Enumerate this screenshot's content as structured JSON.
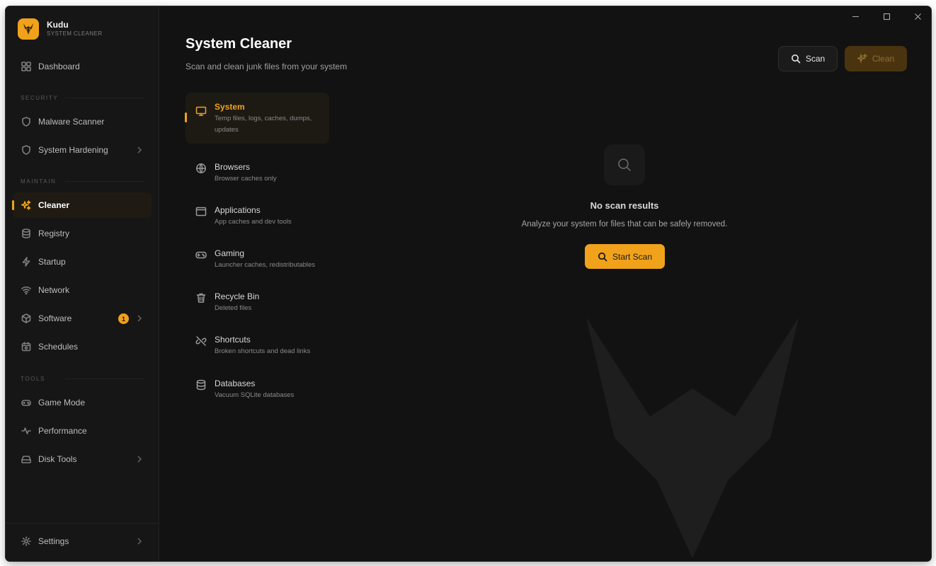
{
  "app": {
    "name": "Kudu",
    "subtitle": "SYSTEM CLEANER"
  },
  "sidebar": {
    "dashboard": "Dashboard",
    "sections": {
      "security": "SECURITY",
      "maintain": "MAINTAIN",
      "tools": "TOOLS"
    },
    "items": {
      "malware_scanner": "Malware Scanner",
      "system_hardening": "System Hardening",
      "cleaner": "Cleaner",
      "registry": "Registry",
      "startup": "Startup",
      "network": "Network",
      "software": "Software",
      "software_badge": "1",
      "schedules": "Schedules",
      "game_mode": "Game Mode",
      "performance": "Performance",
      "disk_tools": "Disk Tools"
    },
    "settings": "Settings"
  },
  "header": {
    "title": "System Cleaner",
    "subtitle": "Scan and clean junk files from your system",
    "scan_label": "Scan",
    "clean_label": "Clean"
  },
  "categories": [
    {
      "title": "System",
      "desc": "Temp files, logs, caches, dumps, updates",
      "icon": "monitor-icon"
    },
    {
      "title": "Browsers",
      "desc": "Browser caches only",
      "icon": "globe-icon"
    },
    {
      "title": "Applications",
      "desc": "App caches and dev tools",
      "icon": "app-window-icon"
    },
    {
      "title": "Gaming",
      "desc": "Launcher caches, redistributables",
      "icon": "gamepad-icon"
    },
    {
      "title": "Recycle Bin",
      "desc": "Deleted files",
      "icon": "trash-icon"
    },
    {
      "title": "Shortcuts",
      "desc": "Broken shortcuts and dead links",
      "icon": "broken-link-icon"
    },
    {
      "title": "Databases",
      "desc": "Vacuum SQLite databases",
      "icon": "database-icon"
    }
  ],
  "empty_state": {
    "title": "No scan results",
    "subtitle": "Analyze your system for files that can be safely removed.",
    "button": "Start Scan"
  },
  "colors": {
    "accent": "#f0a21b",
    "background": "#121212",
    "sidebar": "#161616"
  }
}
